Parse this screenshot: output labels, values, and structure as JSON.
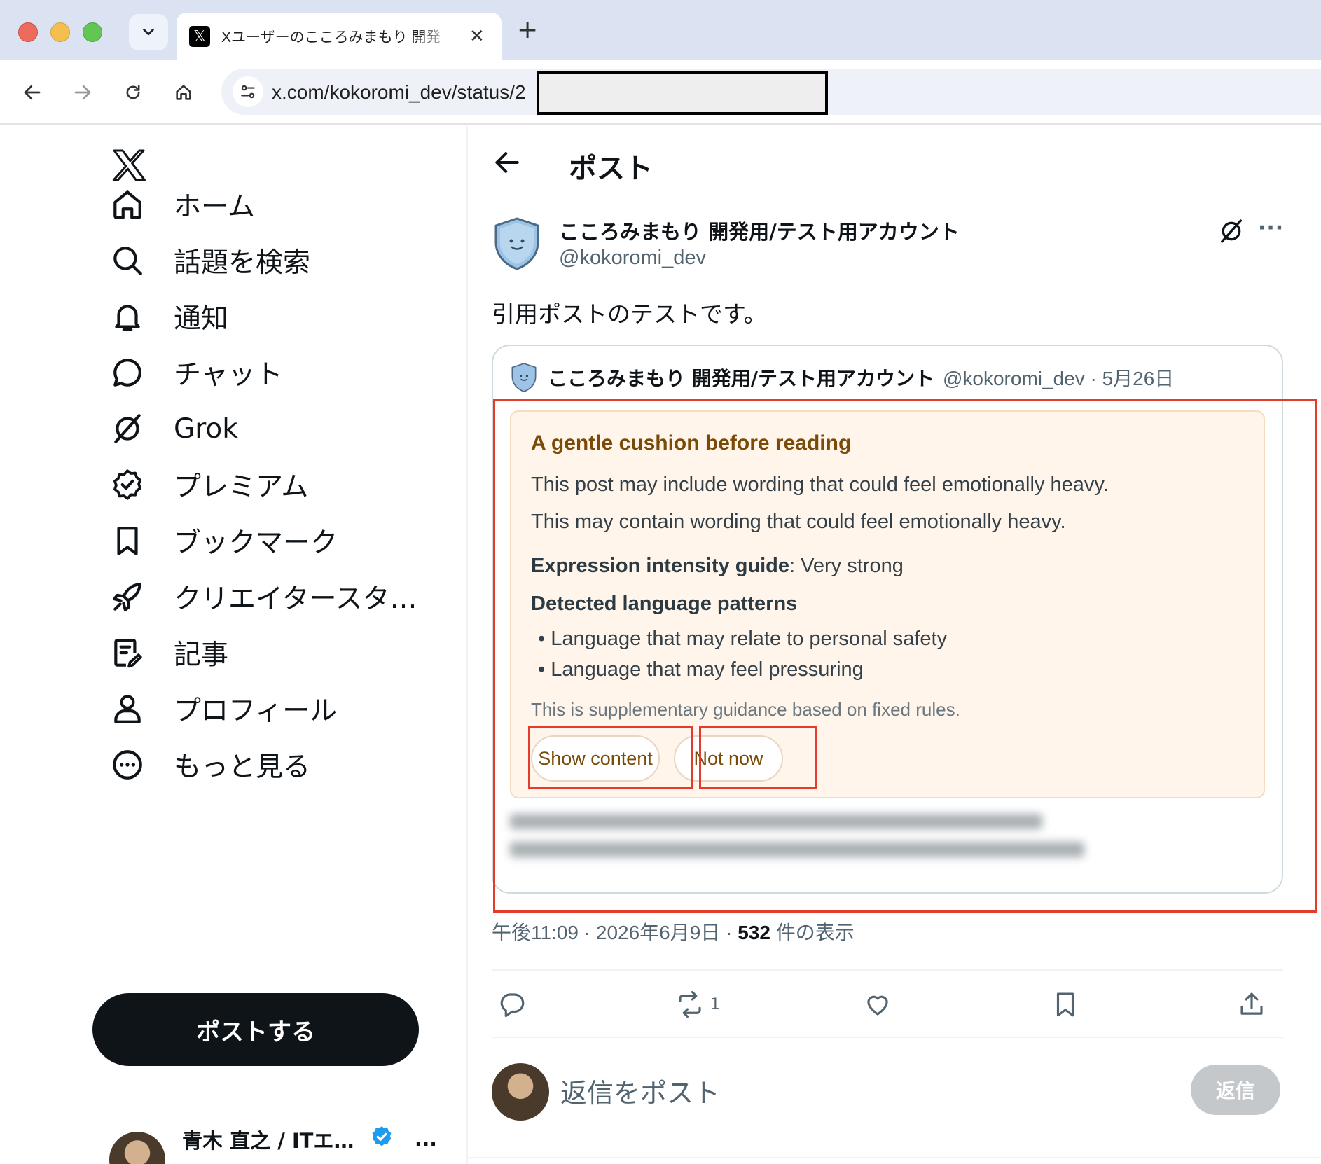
{
  "browser": {
    "tab_title": "Xユーザーのこころみまもり 開発",
    "url": "x.com/kokoromi_dev/status/2"
  },
  "sidebar": {
    "items": [
      {
        "label": "ホーム",
        "icon": "home-icon"
      },
      {
        "label": "話題を検索",
        "icon": "search-icon"
      },
      {
        "label": "通知",
        "icon": "bell-icon"
      },
      {
        "label": "チャット",
        "icon": "chat-icon"
      },
      {
        "label": "Grok",
        "icon": "grok-icon"
      },
      {
        "label": "プレミアム",
        "icon": "verified-badge-icon"
      },
      {
        "label": "ブックマーク",
        "icon": "bookmark-icon"
      },
      {
        "label": "クリエイタースタ…",
        "icon": "rocket-icon"
      },
      {
        "label": "記事",
        "icon": "article-icon"
      },
      {
        "label": "プロフィール",
        "icon": "profile-icon"
      },
      {
        "label": "もっと見る",
        "icon": "more-circle-icon"
      }
    ],
    "post_button": "ポストする",
    "account": {
      "name": "青木 直之 / ITエ…",
      "more": "..."
    }
  },
  "main": {
    "title": "ポスト",
    "post": {
      "author_name": "こころみまもり 開発用/テスト用アカウント",
      "author_handle": "@kokoromi_dev",
      "text": "引用ポストのテストです。",
      "more": "···"
    },
    "quote": {
      "author_name": "こころみまもり 開発用/テスト用アカウント",
      "handle_date": "@kokoromi_dev · 5月26日",
      "cushion": {
        "title": "A gentle cushion before reading",
        "line1": "This post may include wording that could feel emotionally heavy.",
        "line2": "This may contain wording that could feel emotionally heavy.",
        "intensity_label": "Expression intensity guide",
        "intensity_value": ": Very strong",
        "patterns_title": "Detected language patterns",
        "patterns": [
          "• Language that may relate to personal safety",
          "• Language that may feel pressuring"
        ],
        "note": "This is supplementary guidance based on fixed rules.",
        "show_button": "Show content",
        "not_now_button": "Not now"
      }
    },
    "meta": {
      "time": "午後11:09 · 2026年6月9日 · ",
      "views": "532",
      "views_label": " 件の表示"
    },
    "actions": {
      "retweet_count": "1"
    },
    "reply": {
      "placeholder": "返信をポスト",
      "button": "返信"
    }
  },
  "colors": {
    "accent_blue": "#1d9bf0",
    "cushion_bg": "#fff5ea",
    "cushion_title": "#7a4a08",
    "highlight_red": "#e53b2c"
  }
}
